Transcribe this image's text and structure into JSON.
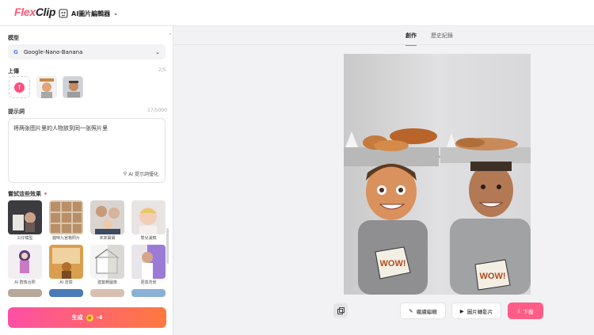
{
  "app": {
    "logo_flex": "Flex",
    "logo_clip": "Clip",
    "editor_label": "AI圖片編輯器"
  },
  "model": {
    "label": "模型",
    "selected": "Google-Nano-Banana"
  },
  "upload": {
    "label": "上傳",
    "count": "2/5"
  },
  "prompt": {
    "label": "提示詞",
    "count": "17/5000",
    "text": "将两张图片里的人物放到同一张照片里",
    "optimize_label": "AI 提示詞優化"
  },
  "effects": {
    "label": "嘗試這些效果",
    "items": [
      {
        "caption": "公仔模型"
      },
      {
        "caption": "貓咪九宮格照片"
      },
      {
        "caption": "未來寶寶"
      },
      {
        "caption": "嬰兒濾鏡"
      },
      {
        "caption": "AI 群像合照"
      },
      {
        "caption": "AI 冒險"
      },
      {
        "caption": "建築轉圖像"
      },
      {
        "caption": "更換背景"
      }
    ]
  },
  "generate": {
    "label": "生成",
    "credits": "4"
  },
  "tabs": [
    {
      "label": "創作"
    },
    {
      "label": "歷史紀錄"
    }
  ],
  "actions": {
    "edit_label": "繼續編輯",
    "video_label": "圖片轉影片",
    "download_label": "下載"
  },
  "colors": {
    "accent": "#ff4f7a",
    "generate_start": "#ff4fa6",
    "generate_end": "#ff7a3d"
  }
}
